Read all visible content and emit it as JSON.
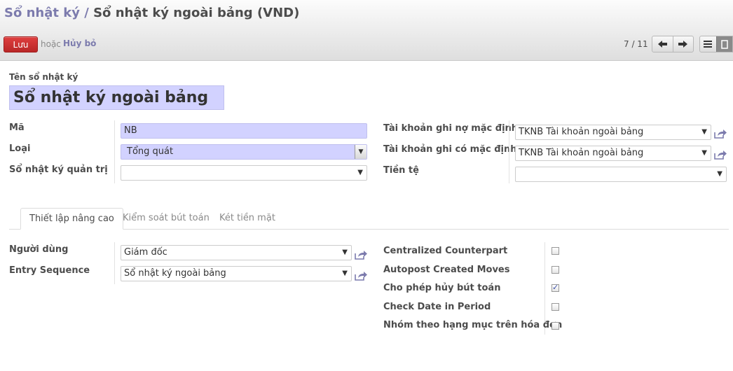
{
  "breadcrumb": {
    "parent": "Sổ nhật ký",
    "separator": "/",
    "current": "Sổ nhật ký ngoài bảng (VND)"
  },
  "toolbar": {
    "save_label": "Lưu",
    "or_label": "hoặc",
    "discard_label": "Hủy bỏ",
    "pager": "7 / 11"
  },
  "form": {
    "name_label": "Tên sổ nhật ký",
    "name_value": "Sổ nhật ký ngoài bảng",
    "code_label": "Mã",
    "code_value": "NB",
    "type_label": "Loại",
    "type_value": "Tổng quát",
    "analytic_label": "Sổ nhật ký quản trị",
    "analytic_value": "",
    "debit_label": "Tài khoản ghi nợ mặc định",
    "debit_value": "TKNB Tài khoản ngoài bảng",
    "credit_label": "Tài khoản ghi có mặc định",
    "credit_value": "TKNB Tài khoản ngoài bảng",
    "currency_label": "Tiền tệ",
    "currency_value": ""
  },
  "tabs": [
    {
      "label": "Thiết lập nâng cao",
      "active": true
    },
    {
      "label": "Kiểm soát bút toán",
      "active": false
    },
    {
      "label": "Két tiền mặt",
      "active": false
    }
  ],
  "advanced": {
    "users_label": "Người dùng",
    "users_value": "Giám đốc",
    "sequence_label": "Entry Sequence",
    "sequence_value": "Sổ nhật ký ngoài bảng",
    "checks": [
      {
        "label": "Centralized Counterpart",
        "checked": false
      },
      {
        "label": "Autopost Created Moves",
        "checked": false
      },
      {
        "label": "Cho phép hủy bút toán",
        "checked": true
      },
      {
        "label": "Check Date in Period",
        "checked": false
      },
      {
        "label": "Nhóm theo hạng mục trên hóa đơn",
        "checked": false
      }
    ]
  },
  "colors": {
    "accent": "#7c7bad",
    "required_bg": "#d2d2ff",
    "save_button": "#c62e2e"
  }
}
